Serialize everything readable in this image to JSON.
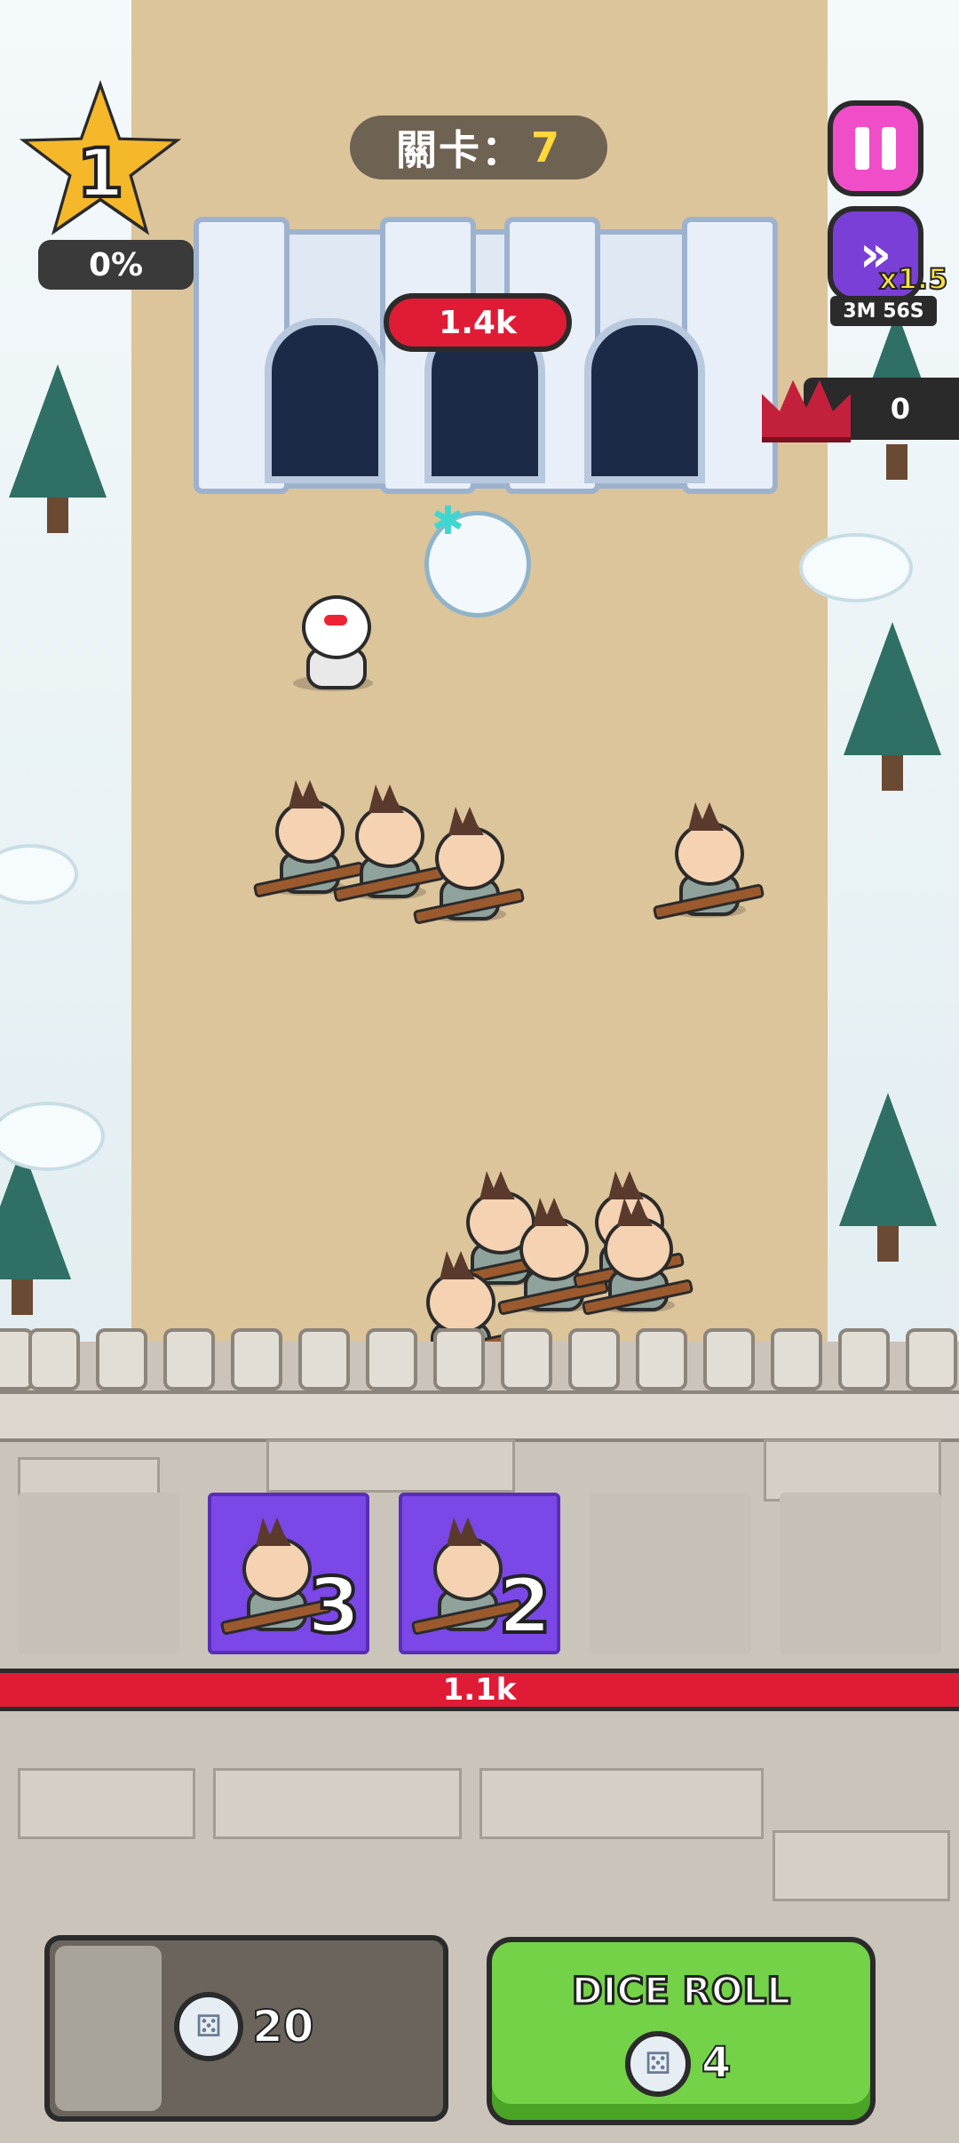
{
  "hud": {
    "stage_label": "關卡：",
    "stage_number": "7",
    "level": "1",
    "level_progress": "0%",
    "speed_multiplier": "x1.5",
    "speed_time_left": "3M 56S",
    "crown_count": "0"
  },
  "enemy_castle": {
    "hp": "1.4k"
  },
  "player_wall": {
    "hp": "1.1k"
  },
  "cards": [
    {
      "unit": "spearman-icon",
      "count": "3"
    },
    {
      "unit": "spearman-icon",
      "count": "2"
    }
  ],
  "bottom": {
    "coins": "20",
    "dice_roll_label": "DICE ROLL",
    "dice_roll_cost": "4"
  },
  "colors": {
    "sand": "#dcc49b",
    "card": "#7b47e6",
    "hp_red": "#e01b35",
    "dice_green": "#74d248",
    "pause_pink": "#f04ec8"
  }
}
